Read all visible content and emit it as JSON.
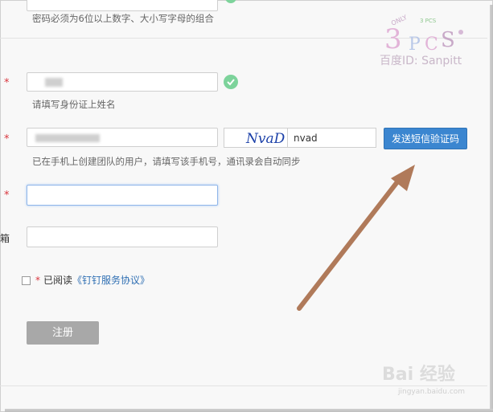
{
  "form": {
    "password_hint": "密码必须为6位以上数字、大小写字母的组合",
    "required_mark": "*",
    "name_hint": "请填写身份证上姓名",
    "phone_hint": "已在手机上创建团队的用户，请填写该手机号，通讯录会自动同步",
    "captcha_text": "NvaD",
    "captcha_value": "nvad",
    "send_sms_label": "发送短信验证码",
    "email_label_fragment": "箱",
    "agree_prefix": "已阅读",
    "agree_link": "《钉钉服务协议》",
    "register_label": "注册"
  },
  "watermark": {
    "top_text": "百度ID: Sanpitt",
    "bottom_text": "Bai 经验",
    "bottom_sub": "jingyan.baidu.com"
  },
  "colors": {
    "accent": "#3b86d0",
    "required": "#d9363e",
    "success": "#7dd39b",
    "arrow": "#b07a5a"
  }
}
